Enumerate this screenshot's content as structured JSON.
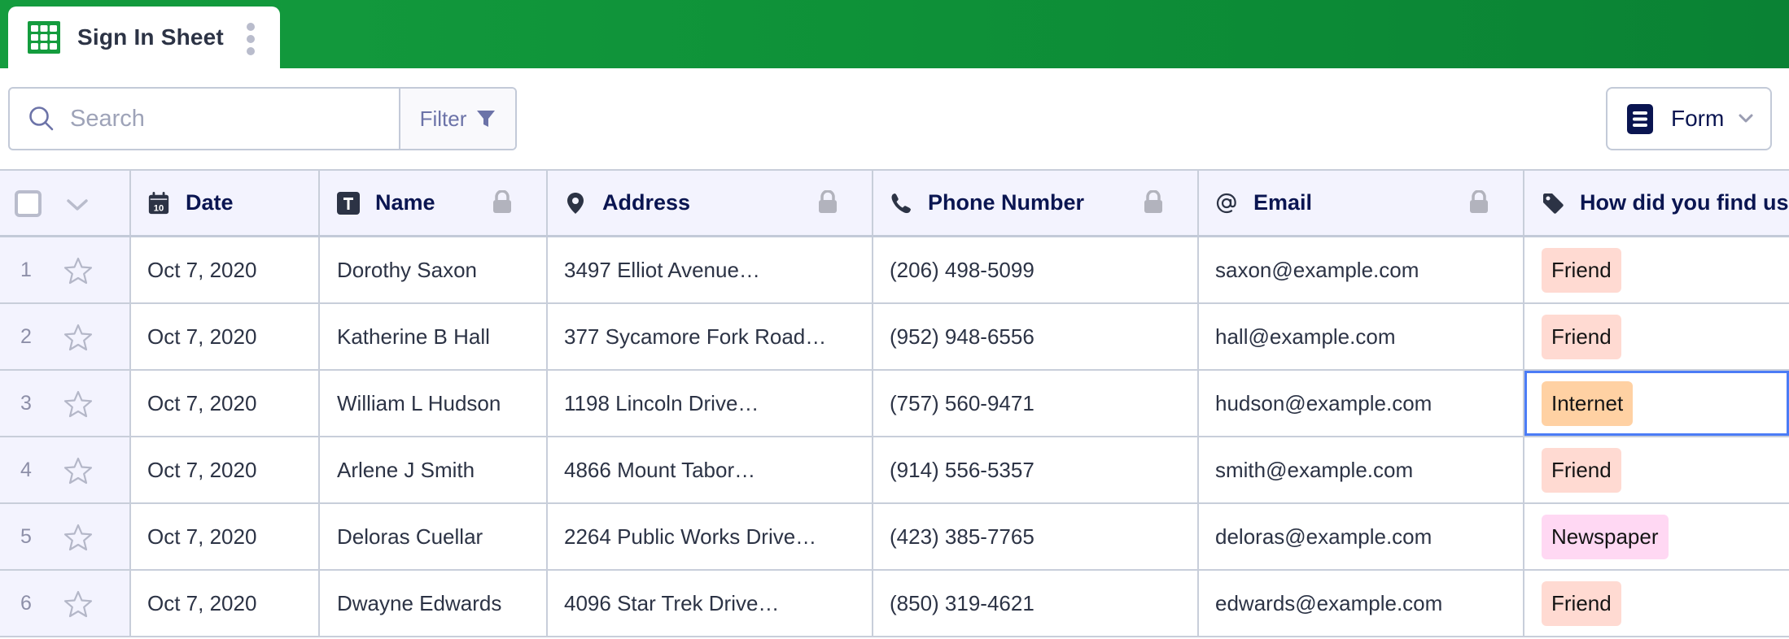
{
  "tab": {
    "label": "Sign In Sheet",
    "icon": "sheet-grid-icon"
  },
  "toolbar": {
    "search_placeholder": "Search",
    "search_value": "",
    "filter_label": "Filter",
    "form_label": "Form"
  },
  "colors": {
    "brand_green": "#0e9138",
    "header_bg": "#f3f3fe",
    "selection_border": "#4b7cf6",
    "badge_friend": "#ffdad2",
    "badge_internet": "#ffd1a3",
    "badge_newspaper": "#ffd8f3"
  },
  "columns": [
    {
      "label": "Date",
      "icon": "calendar-icon",
      "locked": false
    },
    {
      "label": "Name",
      "icon": "text-field-icon",
      "locked": true
    },
    {
      "label": "Address",
      "icon": "location-pin-icon",
      "locked": true
    },
    {
      "label": "Phone Number",
      "icon": "phone-icon",
      "locked": true
    },
    {
      "label": "Email",
      "icon": "at-sign-icon",
      "locked": true
    },
    {
      "label": "How did you find us?",
      "icon": "tag-icon",
      "locked": false
    }
  ],
  "rows": [
    {
      "num": "1",
      "date": "Oct 7, 2020",
      "name": "Dorothy Saxon",
      "address": "3497 Elliot Avenue…",
      "phone": "(206) 498-5099",
      "email": "saxon@example.com",
      "source": "Friend",
      "source_color": "#ffdad2"
    },
    {
      "num": "2",
      "date": "Oct 7, 2020",
      "name": "Katherine B Hall",
      "address": "377 Sycamore Fork Road…",
      "phone": "(952) 948-6556",
      "email": "hall@example.com",
      "source": "Friend",
      "source_color": "#ffdad2"
    },
    {
      "num": "3",
      "date": "Oct 7, 2020",
      "name": "William L Hudson",
      "address": "1198 Lincoln Drive…",
      "phone": "(757) 560-9471",
      "email": "hudson@example.com",
      "source": "Internet",
      "source_color": "#ffd1a3",
      "selected": true
    },
    {
      "num": "4",
      "date": "Oct 7, 2020",
      "name": "Arlene J Smith",
      "address": "4866 Mount Tabor…",
      "phone": "(914) 556-5357",
      "email": "smith@example.com",
      "source": "Friend",
      "source_color": "#ffdad2"
    },
    {
      "num": "5",
      "date": "Oct 7, 2020",
      "name": "Deloras Cuellar",
      "address": "2264 Public Works Drive…",
      "phone": "(423) 385-7765",
      "email": "deloras@example.com",
      "source": "Newspaper",
      "source_color": "#ffd8f3"
    },
    {
      "num": "6",
      "date": "Oct 7, 2020",
      "name": "Dwayne Edwards",
      "address": "4096 Star Trek Drive…",
      "phone": "(850) 319-4621",
      "email": "edwards@example.com",
      "source": "Friend",
      "source_color": "#ffdad2"
    }
  ]
}
